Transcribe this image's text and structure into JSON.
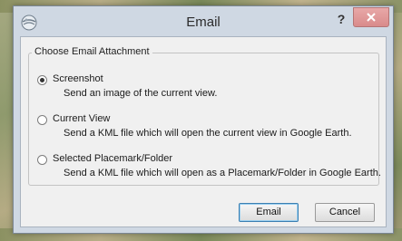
{
  "window": {
    "title": "Email",
    "help_label": "?",
    "close_icon": "close-icon",
    "app_icon": "google-earth-icon"
  },
  "group": {
    "label": "Choose Email Attachment"
  },
  "options": [
    {
      "label": "Screenshot",
      "description": "Send an image of the current view.",
      "checked": true
    },
    {
      "label": "Current View",
      "description": "Send a KML file which will open the current view in Google Earth.",
      "checked": false
    },
    {
      "label": "Selected Placemark/Folder",
      "description": "Send a KML file which will open as a Placemark/Folder in Google Earth.",
      "checked": false
    }
  ],
  "buttons": {
    "email_label": "Email",
    "cancel_label": "Cancel"
  },
  "colors": {
    "close_button": "#d98b8b",
    "default_button_border": "#3c7fb1"
  }
}
